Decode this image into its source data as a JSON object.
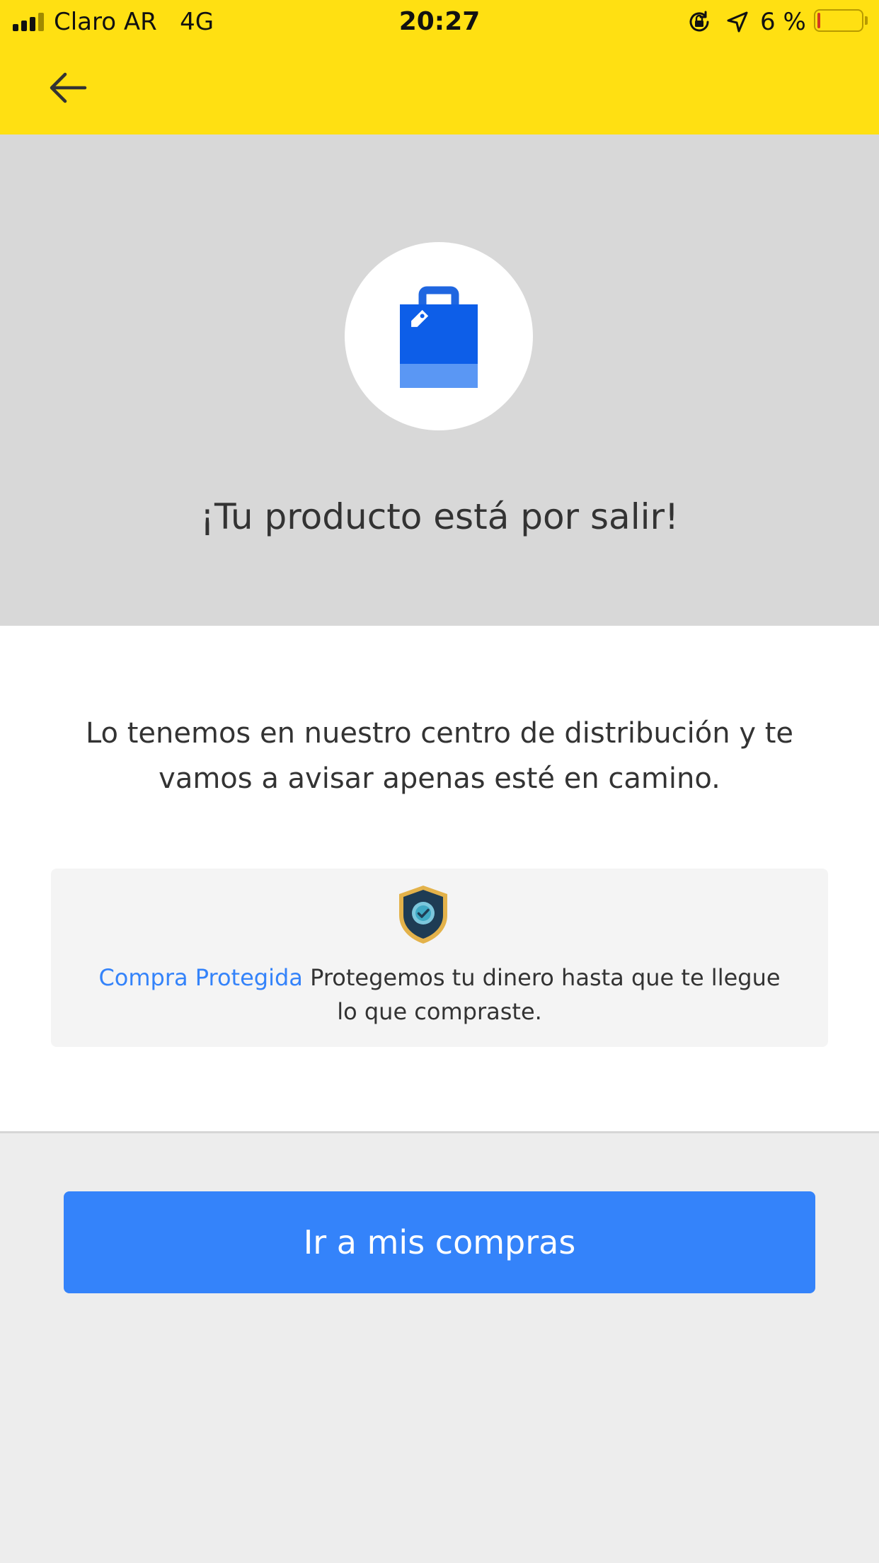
{
  "status_bar": {
    "carrier": "Claro AR   4G",
    "time": "20:27",
    "battery": "6 %",
    "battery_level": 0.06
  },
  "app_bar": {
    "back_icon": "arrow-left-icon"
  },
  "hero": {
    "icon": "shopping-bag-icon",
    "title": "¡Tu producto está por salir!"
  },
  "message": "Lo tenemos en nuestro centro de distribución y te vamos a avisar apenas esté en camino.",
  "protected_purchase": {
    "icon": "shield-check-icon",
    "link_label": "Compra Protegida",
    "text": " Protegemos tu dinero hasta que te llegue lo que compraste."
  },
  "cta": {
    "label": "Ir a mis compras"
  },
  "colors": {
    "app_bar": "#ffe012",
    "primary": "#3483fa",
    "hero_background": "#d8d8d8",
    "footer_background": "#ededed"
  }
}
